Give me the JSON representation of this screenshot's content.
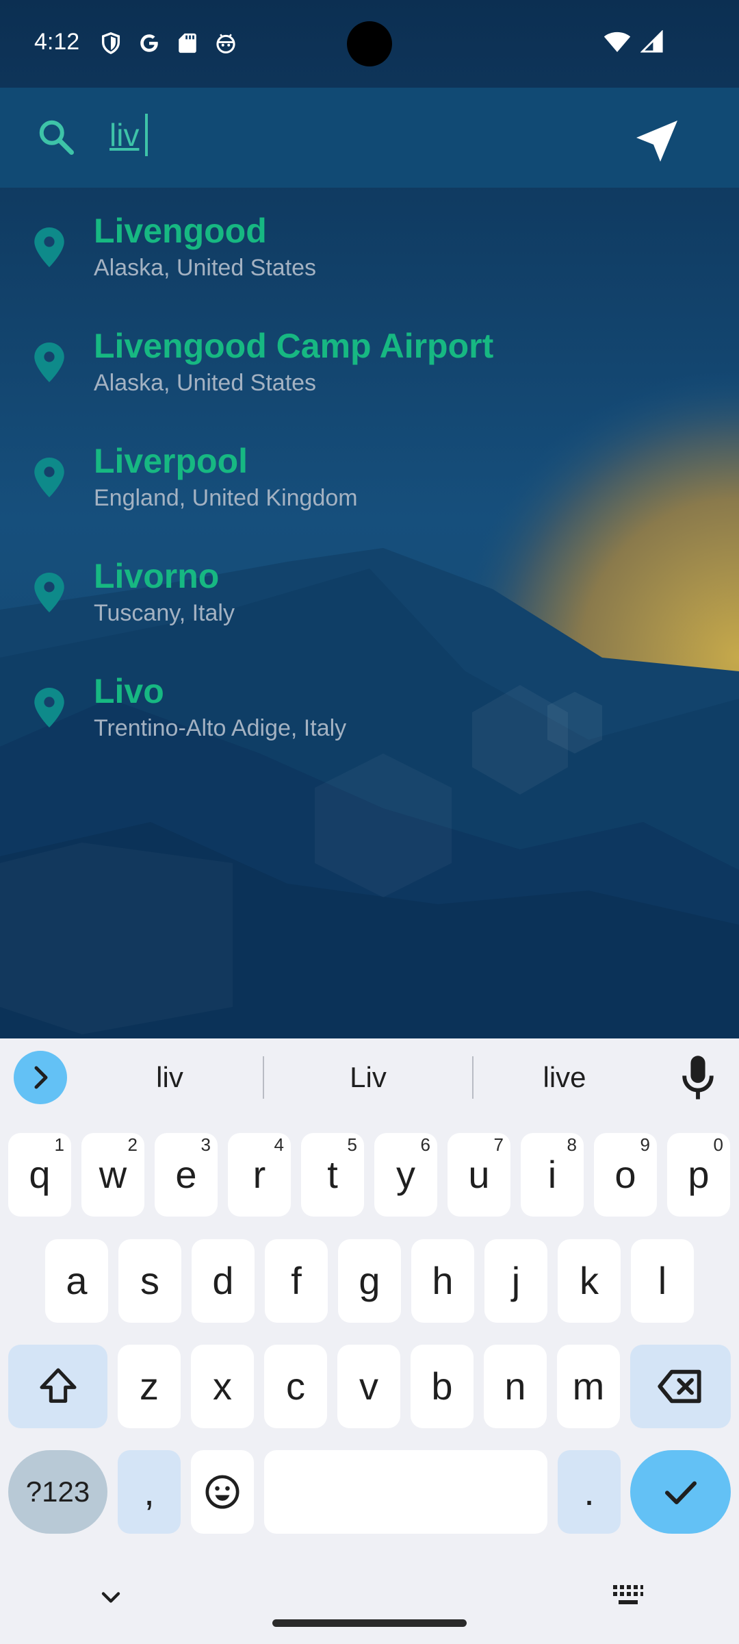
{
  "status_bar": {
    "time": "4:12",
    "left_icons": [
      "shield-icon",
      "google-icon",
      "sd-card-icon",
      "android-face-icon"
    ],
    "right_icons": [
      "wifi-icon",
      "cell-signal-icon"
    ]
  },
  "search": {
    "value": "liv",
    "accent_color": "#3ec3a8"
  },
  "results": [
    {
      "name": "Livengood",
      "region": "Alaska, United States"
    },
    {
      "name": "Livengood Camp Airport",
      "region": "Alaska, United States"
    },
    {
      "name": "Liverpool",
      "region": "England, United Kingdom"
    },
    {
      "name": "Livorno",
      "region": "Tuscany, Italy"
    },
    {
      "name": "Livo",
      "region": "Trentino-Alto Adige, Italy"
    }
  ],
  "colors": {
    "result_name": "#17b882",
    "result_region": "#a4b2c2",
    "pin": "#0e8a8a"
  },
  "keyboard": {
    "suggestions": [
      "liv",
      "Liv",
      "live"
    ],
    "row1": [
      {
        "key": "q",
        "hint": "1"
      },
      {
        "key": "w",
        "hint": "2"
      },
      {
        "key": "e",
        "hint": "3"
      },
      {
        "key": "r",
        "hint": "4"
      },
      {
        "key": "t",
        "hint": "5"
      },
      {
        "key": "y",
        "hint": "6"
      },
      {
        "key": "u",
        "hint": "7"
      },
      {
        "key": "i",
        "hint": "8"
      },
      {
        "key": "o",
        "hint": "9"
      },
      {
        "key": "p",
        "hint": "0"
      }
    ],
    "row2": [
      "a",
      "s",
      "d",
      "f",
      "g",
      "h",
      "j",
      "k",
      "l"
    ],
    "row3": [
      "z",
      "x",
      "c",
      "v",
      "b",
      "n",
      "m"
    ],
    "symbols_label": "?123",
    "comma": ",",
    "period": "."
  }
}
